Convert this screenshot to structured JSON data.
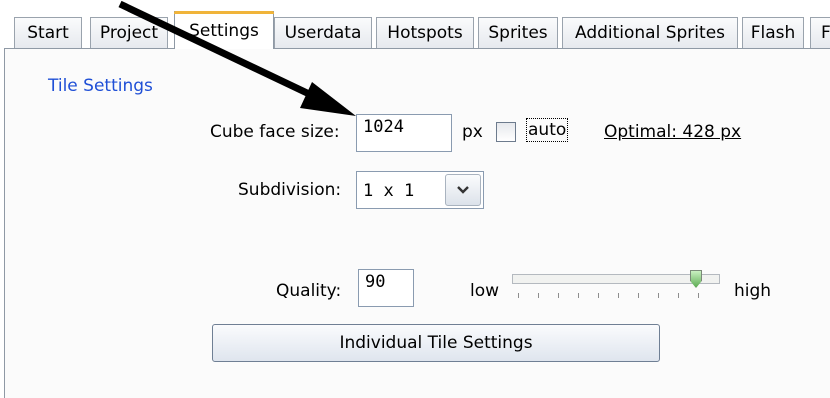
{
  "tabs": [
    {
      "label": "Start"
    },
    {
      "label": "Project"
    },
    {
      "label": "Settings",
      "active": true
    },
    {
      "label": "Userdata"
    },
    {
      "label": "Hotspots"
    },
    {
      "label": "Sprites"
    },
    {
      "label": "Additional Sprites"
    },
    {
      "label": "Flash"
    },
    {
      "label": "F"
    }
  ],
  "tile_settings": {
    "legend": "Tile Settings",
    "cube_face": {
      "label": "Cube face size:",
      "value": "1024",
      "unit": "px"
    },
    "auto": {
      "label": "auto",
      "checked": false
    },
    "optimal": "Optimal: 428 px",
    "subdivision": {
      "label": "Subdivision:",
      "value": "1 x 1"
    },
    "quality": {
      "label": "Quality:",
      "value": "90",
      "low_label": "low",
      "high_label": "high",
      "slider_value": 90
    },
    "individual_button": "Individual Tile Settings"
  },
  "colors": {
    "legend": "#1f4fd6",
    "active_tab_accent": "#f0b43a",
    "slider_thumb": "#5fae55"
  },
  "icons": {
    "dropdown": "chevron-down-icon",
    "annotation": "arrow-annotation-icon"
  }
}
